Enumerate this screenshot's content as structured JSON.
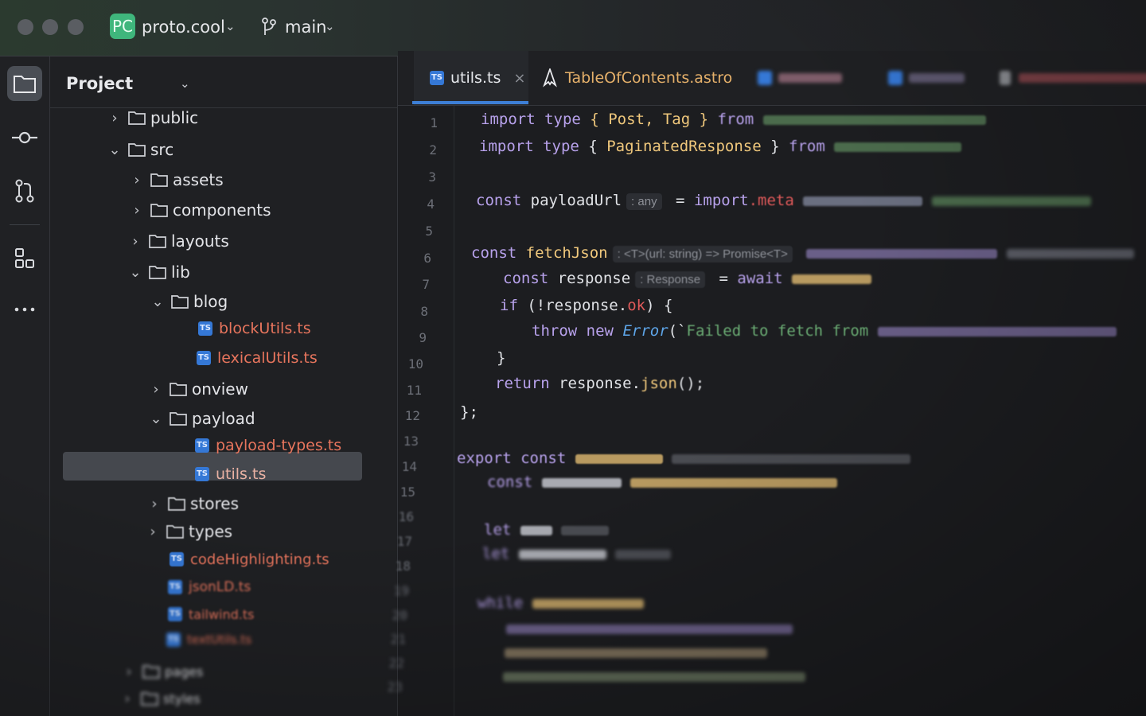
{
  "titlebar": {
    "project_badge": "PC",
    "project_name": "proto.cool",
    "branch": "main"
  },
  "toolstrip": {
    "icons": [
      "folder-icon",
      "commit-icon",
      "pull-request-icon",
      "structure-icon",
      "more-icon"
    ]
  },
  "project_panel": {
    "title": "Project",
    "tree": [
      {
        "label": "public",
        "kind": "dir",
        "expanded": false
      },
      {
        "label": "src",
        "kind": "dir",
        "expanded": true
      },
      {
        "label": "assets",
        "kind": "dir",
        "expanded": false
      },
      {
        "label": "components",
        "kind": "dir",
        "expanded": false
      },
      {
        "label": "layouts",
        "kind": "dir",
        "expanded": false
      },
      {
        "label": "lib",
        "kind": "dir",
        "expanded": true
      },
      {
        "label": "blog",
        "kind": "dir",
        "expanded": true
      },
      {
        "label": "blockUtils.ts",
        "kind": "ts"
      },
      {
        "label": "lexicalUtils.ts",
        "kind": "ts"
      },
      {
        "label": "onview",
        "kind": "dir",
        "expanded": false
      },
      {
        "label": "payload",
        "kind": "dir",
        "expanded": true
      },
      {
        "label": "payload-types.ts",
        "kind": "ts"
      },
      {
        "label": "utils.ts",
        "kind": "ts",
        "selected": true
      },
      {
        "label": "stores",
        "kind": "dir",
        "expanded": false
      },
      {
        "label": "types",
        "kind": "dir",
        "expanded": false
      },
      {
        "label": "codeHighlighting.ts",
        "kind": "ts"
      },
      {
        "label": "jsonLD.ts",
        "kind": "ts"
      },
      {
        "label": "tailwind.ts",
        "kind": "ts"
      },
      {
        "label": "textUtils.ts",
        "kind": "ts"
      },
      {
        "label": "pages",
        "kind": "dir",
        "expanded": false
      },
      {
        "label": "styles",
        "kind": "dir",
        "expanded": false
      }
    ]
  },
  "tabs": [
    {
      "label": "utils.ts",
      "active": true,
      "close": "×"
    },
    {
      "label": "TableOfContents.astro",
      "active": false
    }
  ],
  "editor": {
    "line_numbers": [
      "1",
      "2",
      "3",
      "4",
      "5",
      "6",
      "7",
      "8",
      "9",
      "10",
      "11",
      "12",
      "13",
      "14",
      "15",
      "16",
      "17",
      "18",
      "19",
      "20",
      "21",
      "22",
      "23"
    ],
    "hints": {
      "payload_type": ": any",
      "fetch_type": ": <T>(url: string) => Promise<T>",
      "response_type": ": Response"
    },
    "code": {
      "l1_import": "import",
      "l1_type": "type",
      "l1_braces": "{ Post, Tag }",
      "l1_from": "from",
      "l2_import": "import",
      "l2_type": "type",
      "l2_braces_open": "{",
      "l2_name": "PaginatedResponse",
      "l2_braces_close": "}",
      "l2_from": "from",
      "l4_const": "const",
      "l4_name": "payloadUrl",
      "l4_eq": "=",
      "l4_import": "import",
      "l4_meta": ".meta",
      "l6_const": "const",
      "l6_name": "fetchJson",
      "l7_const": "const",
      "l7_name": "response",
      "l7_eq": "=",
      "l7_await": "await",
      "l8_if": "if",
      "l8_cond_open": "(!response.",
      "l8_ok": "ok",
      "l8_cond_close": ") {",
      "l9_throw": "throw",
      "l9_new": "new",
      "l9_error": "Error",
      "l9_paren": "(`",
      "l9_msg": "Failed to fetch from",
      "l10_brace": "}",
      "l11_return": "return",
      "l11_expr": "response.",
      "l11_json": "json",
      "l11_end": "();",
      "l12_end": "};",
      "l14_export": "export",
      "l14_const": "const",
      "l15_const": "const",
      "l17_let": "let",
      "l18_let": "let",
      "l20_while": "while"
    }
  },
  "colors": {
    "accent": "#3d7fd6",
    "badge": "#3fb67c",
    "ts_file": "#e8755d",
    "keyword": "#cf8e6d",
    "type": "#f0c87c"
  }
}
